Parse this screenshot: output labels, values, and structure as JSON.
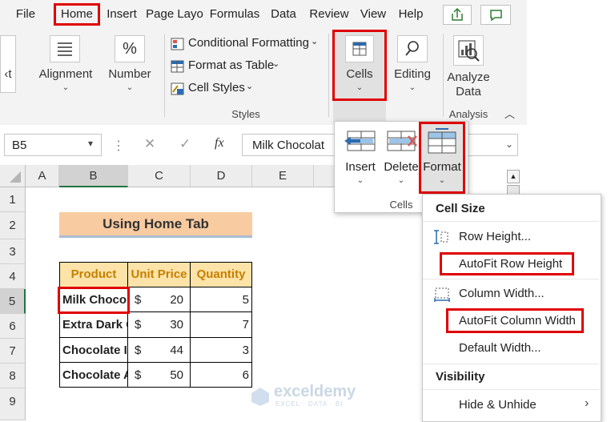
{
  "menu": {
    "items": [
      "File",
      "Home",
      "Insert",
      "Page Layo",
      "Formulas",
      "Data",
      "Review",
      "View",
      "Help"
    ]
  },
  "ribbon": {
    "partial_label": "‹t",
    "alignment_label": "Alignment",
    "number_label": "Number",
    "conditional_formatting": "Conditional Formatting",
    "format_as_table": "Format as Table",
    "cell_styles": "Cell Styles",
    "styles_group": "Styles",
    "cells_label": "Cells",
    "editing_label": "Editing",
    "analyze_data_line1": "Analyze",
    "analyze_data_line2": "Data",
    "analysis_group": "Analysis"
  },
  "formula_bar": {
    "cell_ref": "B5",
    "fx": "fx",
    "content": "Milk Chocolat"
  },
  "cells_panel": {
    "insert": "Insert",
    "delete": "Delete",
    "format": "Format",
    "group_label": "Cells"
  },
  "grid": {
    "columns": [
      "A",
      "B",
      "C",
      "D",
      "E"
    ],
    "rows": [
      "1",
      "2",
      "3",
      "4",
      "5",
      "6",
      "7",
      "8",
      "9"
    ],
    "title": "Using Home Tab",
    "headers": [
      "Product",
      "Unit Price",
      "Quantity"
    ],
    "data": [
      {
        "product": "Milk Choco",
        "currency": "$",
        "price": "20",
        "qty": "5"
      },
      {
        "product": "Extra Dark C",
        "currency": "$",
        "price": "30",
        "qty": "7"
      },
      {
        "product": "Chocolate I",
        "currency": "$",
        "price": "44",
        "qty": "3"
      },
      {
        "product": "Chocolate A",
        "currency": "$",
        "price": "50",
        "qty": "6"
      }
    ]
  },
  "format_menu": {
    "cell_size_header": "Cell Size",
    "row_height": "Row Height...",
    "autofit_row_height": "AutoFit Row Height",
    "column_width": "Column Width...",
    "autofit_column_width": "AutoFit Column Width",
    "default_width": "Default Width...",
    "visibility_header": "Visibility",
    "hide_unhide": "Hide & Unhide"
  },
  "watermark": {
    "name": "exceldemy",
    "tagline": "EXCEL · DATA · BI"
  },
  "colors": {
    "highlight_red": "#e00000",
    "title_fill": "#f8cba0",
    "header_fill": "#fde3a7",
    "header_text": "#c67f00",
    "accent_blue": "#2b6cb0"
  }
}
